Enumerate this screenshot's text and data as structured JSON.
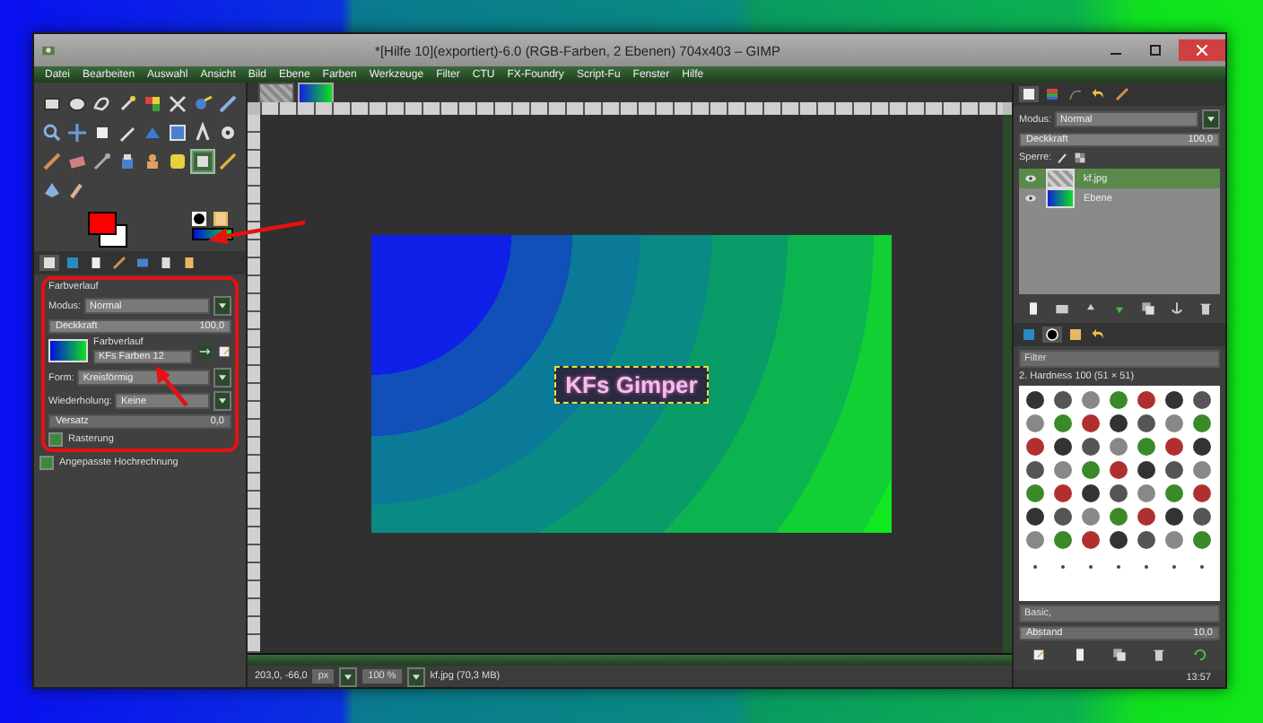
{
  "window": {
    "title": "*[Hilfe 10](exportiert)-6.0 (RGB-Farben, 2 Ebenen) 704x403 – GIMP"
  },
  "menu": [
    "Datei",
    "Bearbeiten",
    "Auswahl",
    "Ansicht",
    "Bild",
    "Ebene",
    "Farben",
    "Werkzeuge",
    "Filter",
    "CTU",
    "FX-Foundry",
    "Script-Fu",
    "Fenster",
    "Hilfe"
  ],
  "tools": [
    {
      "selected": false
    },
    {
      "selected": false
    },
    {
      "selected": false
    },
    {
      "selected": false
    },
    {
      "selected": false
    },
    {
      "selected": false
    },
    {
      "selected": false
    },
    {
      "selected": false
    },
    {
      "selected": false
    },
    {
      "selected": false
    },
    {
      "selected": false
    },
    {
      "selected": false
    },
    {
      "selected": false
    },
    {
      "selected": false
    },
    {
      "selected": false
    },
    {
      "selected": false
    },
    {
      "selected": false
    },
    {
      "selected": false
    },
    {
      "selected": false
    },
    {
      "selected": false
    },
    {
      "selected": false
    },
    {
      "selected": false
    },
    {
      "selected": true
    },
    {
      "selected": false
    },
    {
      "selected": false
    },
    {
      "selected": false
    }
  ],
  "tool_options": {
    "title": "Farbverlauf",
    "mode": {
      "label": "Modus:",
      "value": "Normal"
    },
    "opacity": {
      "label": "Deckkraft",
      "reading": "100,0",
      "level": 1
    },
    "gradient": {
      "label": "Farbverlauf",
      "value": "KFs Farben 12"
    },
    "shape": {
      "label": "Form:",
      "value": "Kreisförmig"
    },
    "repeat": {
      "label": "Wiederholung:",
      "value": "Keine"
    },
    "offset": {
      "label": "Versatz",
      "reading": "0,0",
      "level": 0
    },
    "checkboxes": [
      {
        "label": "Rasterung",
        "checked": true
      },
      {
        "label": "Angepasste Hochrechnung",
        "checked": true
      }
    ]
  },
  "image_tabs": [
    {
      "selected": false
    },
    {
      "selected": true
    }
  ],
  "canvas": {
    "image_text": "KFs Gimper"
  },
  "status": {
    "coords": "203,0, -66,0",
    "unit": "px",
    "zoom": "100 %",
    "file": "kf.jpg (70,3 MB)"
  },
  "layers_panel": {
    "mode": {
      "label": "Modus:",
      "value": "Normal"
    },
    "opacity": {
      "label": "Deckkraft",
      "reading": "100,0",
      "level": 1
    },
    "lock_label": "Sperre:",
    "layers": [
      {
        "name": "kf.jpg",
        "selected": true,
        "visible": true
      },
      {
        "name": "Ebene",
        "selected": false,
        "visible": true
      }
    ]
  },
  "brushes_panel": {
    "filter_placeholder": "Filter",
    "title": "2. Hardness 100 (51 × 51)",
    "tag": "Basic,",
    "spacing": {
      "label": "Abstand",
      "reading": "10,0",
      "level": 0.1
    }
  },
  "clock": "13:57"
}
